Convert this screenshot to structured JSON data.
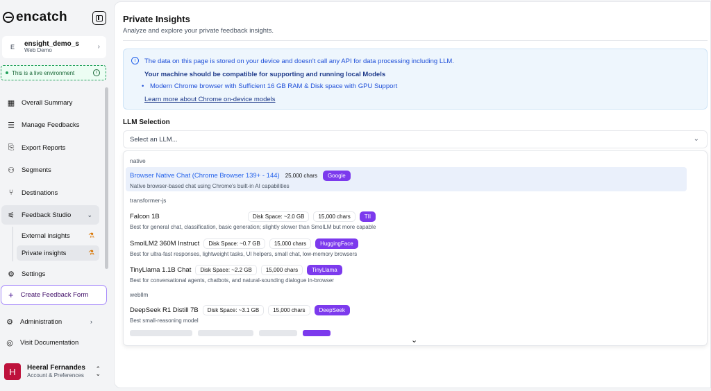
{
  "app": {
    "logo_text": "encatch"
  },
  "workspace": {
    "initial": "E",
    "name": "ensight_demo_s",
    "subtitle": "Web Demo"
  },
  "environment": {
    "label": "This is a live environment"
  },
  "nav": {
    "overall_summary": "Overall Summary",
    "manage_feedbacks": "Manage Feedbacks",
    "export_reports": "Export Reports",
    "segments": "Segments",
    "destinations": "Destinations",
    "feedback_studio": "Feedback Studio",
    "external_insights": "External insights",
    "private_insights": "Private insights",
    "settings": "Settings",
    "create_feedback_form": "Create Feedback Form",
    "administration": "Administration",
    "visit_documentation": "Visit Documentation"
  },
  "user": {
    "initial": "H",
    "name": "Heeral Fernandes",
    "subtitle": "Account & Preferences"
  },
  "page": {
    "title": "Private Insights",
    "subtitle": "Analyze and explore your private feedback insights."
  },
  "info": {
    "line1": "The data on this page is stored on your device and doesn't call any API for data processing including LLM.",
    "line2": "Your machine should be compatible for supporting and running local Models",
    "bullet": "Modern Chrome browser with Sufficient 16 GB RAM & Disk space with GPU Support",
    "link": "Learn more about Chrome on-device models"
  },
  "llm": {
    "label": "LLM Selection",
    "placeholder": "Select an LLM...",
    "groups": {
      "native": "native",
      "transformer": "transformer-js",
      "webllm": "webllm"
    },
    "options": [
      {
        "name": "Browser Native Chat (Chrome Browser 139+ - 144)",
        "chars": "25,000 chars",
        "badge": "Google",
        "desc": "Native browser-based chat using Chrome's built-in AI capabilities"
      },
      {
        "name": "Falcon 1B",
        "disk": "Disk Space: ~2.0 GB",
        "chars": "15,000 chars",
        "badge": "TII",
        "desc": "Best for general chat, classification, basic generation; slightly slower than SmolLM but more capable"
      },
      {
        "name": "SmolLM2 360M Instruct",
        "disk": "Disk Space: ~0.7 GB",
        "chars": "15,000 chars",
        "badge": "HuggingFace",
        "desc": "Best for ultra-fast responses, lightweight tasks, UI helpers, small chat, low-memory browsers"
      },
      {
        "name": "TinyLlama 1.1B Chat",
        "disk": "Disk Space: ~2.2 GB",
        "chars": "15,000 chars",
        "badge": "TinyLlama",
        "desc": "Best for conversational agents, chatbots, and natural-sounding dialogue in-browser"
      },
      {
        "name": "DeepSeek R1 Distill 7B",
        "disk": "Disk Space: ~3.1 GB",
        "chars": "15,000 chars",
        "badge": "DeepSeek",
        "desc": "Best small-reasoning model"
      }
    ]
  },
  "colors": {
    "accent": "#7c3aed",
    "info_bg": "#eef6fd",
    "live_green": "#22a05b",
    "avatar_red": "#be123c"
  }
}
